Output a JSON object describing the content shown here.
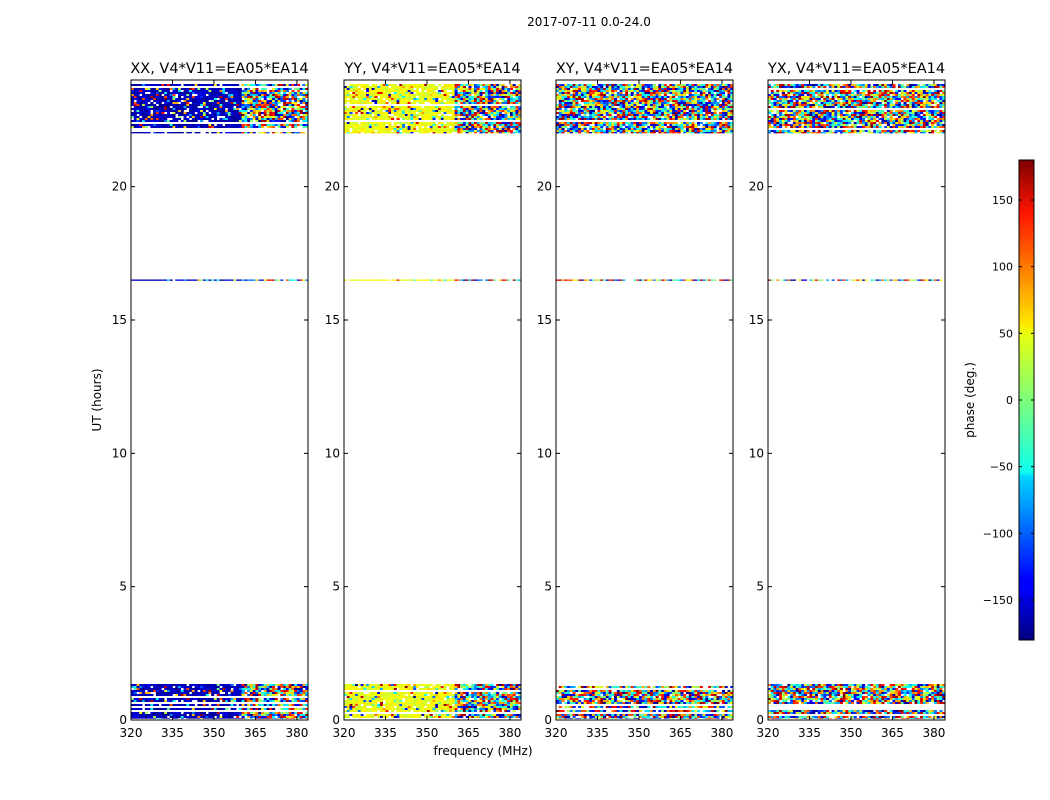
{
  "figure": {
    "suptitle": "2017-07-11 0.0-24.0",
    "xlabel": "frequency (MHz)",
    "ylabel": "UT (hours)",
    "colorbar_label": "phase (deg.)"
  },
  "chart_data": {
    "type": "heatmap",
    "colormap": "jet",
    "clim": [
      -180,
      180
    ],
    "xlim": [
      320,
      384
    ],
    "ylim": [
      0,
      24
    ],
    "x_ticks": [
      320,
      335,
      350,
      365,
      380
    ],
    "y_ticks": [
      0,
      5,
      10,
      15,
      20
    ],
    "colorbar_ticks": [
      -150,
      -100,
      -50,
      0,
      50,
      100,
      150
    ],
    "colorbar_tick_labels": [
      "−150",
      "−100",
      "−50",
      "0",
      "50",
      "100",
      "150"
    ],
    "grid": false,
    "data_time_ranges_hours": [
      [
        0.05,
        1.35
      ],
      [
        16.47,
        16.52
      ],
      [
        22.0,
        23.85
      ]
    ],
    "panels": [
      {
        "title": "XX, V4*V11=EA05*EA14",
        "dominant_phase_deg": -160
      },
      {
        "title": "YY, V4*V11=EA05*EA14",
        "dominant_phase_deg": 40
      },
      {
        "title": "XY, V4*V11=EA05*EA14",
        "dominant_phase_deg": null
      },
      {
        "title": "YX, V4*V11=EA05*EA14",
        "dominant_phase_deg": null
      }
    ]
  }
}
